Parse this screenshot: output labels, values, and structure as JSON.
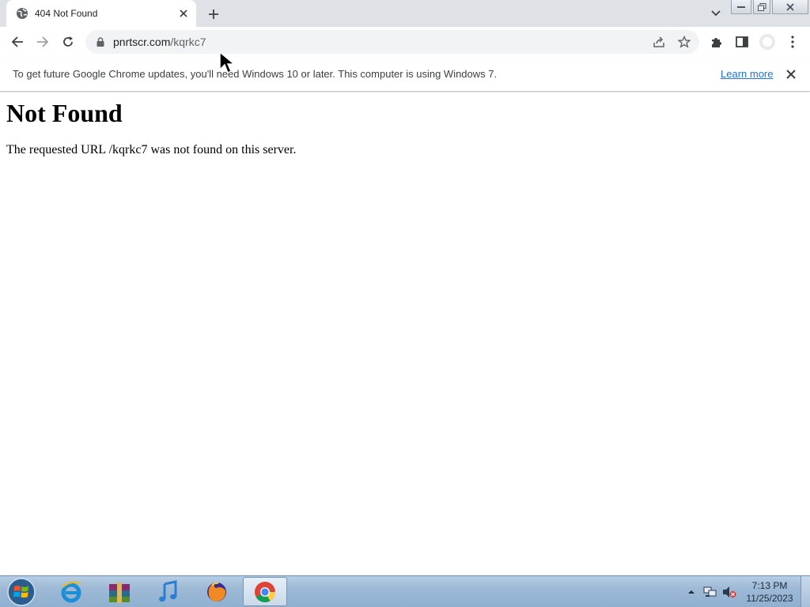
{
  "browser": {
    "tab": {
      "title": "404 Not Found"
    },
    "address_bar": {
      "domain": "pnrtscr.com",
      "path": "/kqrkc7"
    }
  },
  "infobar": {
    "message": "To get future Google Chrome updates, you'll need Windows 10 or later. This computer is using Windows 7.",
    "link_label": "Learn more"
  },
  "page": {
    "heading": "Not Found",
    "body": "The requested URL /kqrkc7 was not found on this server."
  },
  "taskbar": {
    "apps": [
      "internet-explorer",
      "winrar",
      "itunes",
      "firefox",
      "chrome"
    ],
    "active_app": "chrome",
    "clock": {
      "time": "7:13 PM",
      "date": "11/25/2023"
    }
  },
  "colors": {
    "tabstrip_bg": "#dee1e6",
    "link": "#1a73e8",
    "taskbar_bg": "#9db9d6"
  }
}
